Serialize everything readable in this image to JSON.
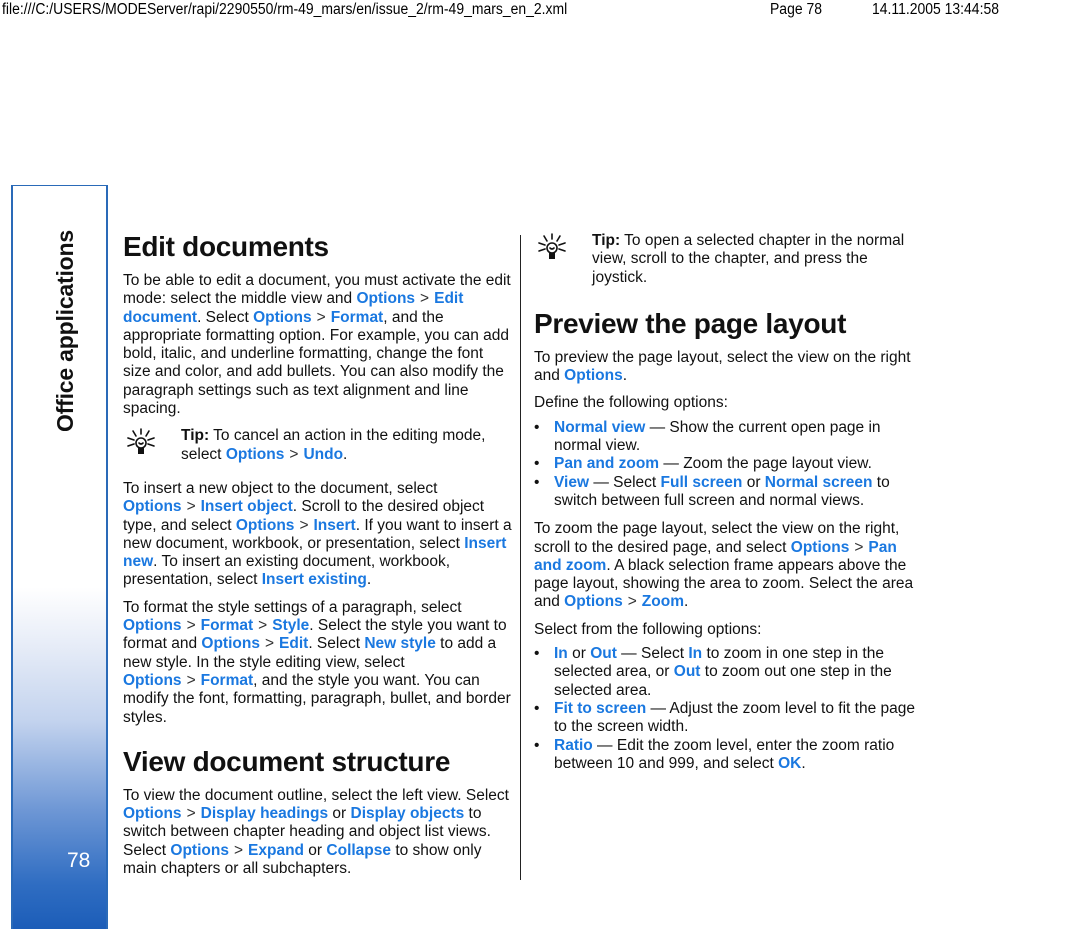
{
  "header": {
    "path": "file:///C:/USERS/MODEServer/rapi/2290550/rm-49_mars/en/issue_2/rm-49_mars_en_2.xml",
    "page": "Page 78",
    "datetime": "14.11.2005 13:44:58"
  },
  "sidebar": {
    "section_title": "Office applications",
    "page_number": "78",
    "accent_color": "#2a6ab8"
  },
  "separator": ">",
  "bullet": "•",
  "link_color": "#1a78e0",
  "left": {
    "edit": {
      "heading": "Edit documents",
      "p1": {
        "t1": "To be able to edit a document, you must activate the edit mode: select the middle view and ",
        "l1": "Options",
        "l2": "Edit document",
        "t2": ". Select ",
        "l3": "Options",
        "l4": "Format",
        "t3": ", and the appropriate formatting option. For example, you can add bold, italic, and underline formatting, change the font size and color, and add bullets. You can also modify the paragraph settings such as text alignment and line spacing."
      },
      "tip": {
        "label": "Tip:",
        "t1": " To cancel an action in the editing mode, select ",
        "l1": "Options",
        "l2": "Undo",
        "t2": "."
      },
      "p2": {
        "t1": "To insert a new object to the document, select ",
        "l1": "Options",
        "l2": "Insert object",
        "t2": ". Scroll to the desired object type, and select ",
        "l3": "Options",
        "l4": "Insert",
        "t3": ". If you want to insert a new document, workbook, or presentation, select ",
        "l5": "Insert new",
        "t4": ". To insert an existing document, workbook, presentation, select ",
        "l6": "Insert existing",
        "t5": "."
      },
      "p3": {
        "t1": "To format the style settings of a paragraph, select ",
        "l1": "Options",
        "l2": "Format",
        "l3": "Style",
        "t2": ". Select the style you want to format and ",
        "l4": "Options",
        "l5": "Edit",
        "t3": ". Select ",
        "l6": "New style",
        "t4": " to add a new style. In the style editing view, select ",
        "l7": "Options",
        "l8": "Format",
        "t5": ", and the style you want. You can modify the font, formatting, paragraph, bullet, and border styles."
      }
    },
    "structure": {
      "heading": "View document structure",
      "p1": {
        "t1": "To view the document outline, select the left view. Select ",
        "l1": "Options",
        "l2": "Display headings",
        "t2": " or ",
        "l3": "Display objects",
        "t3": " to switch between chapter heading and object list views. Select ",
        "l4": "Options",
        "l5": "Expand",
        "t4": " or ",
        "l6": "Collapse",
        "t5": " to show only main chapters or all subchapters."
      }
    }
  },
  "right": {
    "tip": {
      "label": "Tip:",
      "text": " To open a selected chapter in the normal view, scroll to the chapter, and press the joystick."
    },
    "preview": {
      "heading": "Preview the page layout",
      "p1": {
        "t1": "To preview the page layout, select the view on the right and ",
        "l1": "Options",
        "t2": "."
      },
      "p2": "Define the following options:",
      "options": [
        {
          "term": "Normal view",
          "text": " — Show the current open page in normal view."
        },
        {
          "term": "Pan and zoom",
          "text": " — Zoom the page layout view."
        },
        {
          "term": "View",
          "text": " — Select ",
          "l1": "Full screen",
          "mid": " or ",
          "l2": "Normal screen",
          "tail": " to switch between full screen and normal views."
        }
      ],
      "p3": {
        "t1": "To zoom the page layout, select the view on the right, scroll to the desired page, and select ",
        "l1": "Options",
        "l2": "Pan and zoom",
        "t2": ". A black selection frame appears above the page layout, showing the area to zoom. Select the area and ",
        "l3": "Options",
        "l4": "Zoom",
        "t3": "."
      },
      "p4": "Select from the following options:",
      "zoom_options": [
        {
          "term": "In",
          "mid1": " or ",
          "term2": "Out",
          "text": " — Select ",
          "l1": "In",
          "t2": " to zoom in one step in the selected area, or ",
          "l2": "Out",
          "t3": " to zoom out one step in the selected area."
        },
        {
          "term": "Fit to screen",
          "text": " — Adjust the zoom level to fit the page to the screen width."
        },
        {
          "term": "Ratio",
          "text": " — Edit the zoom level, enter the zoom ratio between 10 and 999, and select ",
          "l1": "OK",
          "t2": "."
        }
      ]
    }
  }
}
